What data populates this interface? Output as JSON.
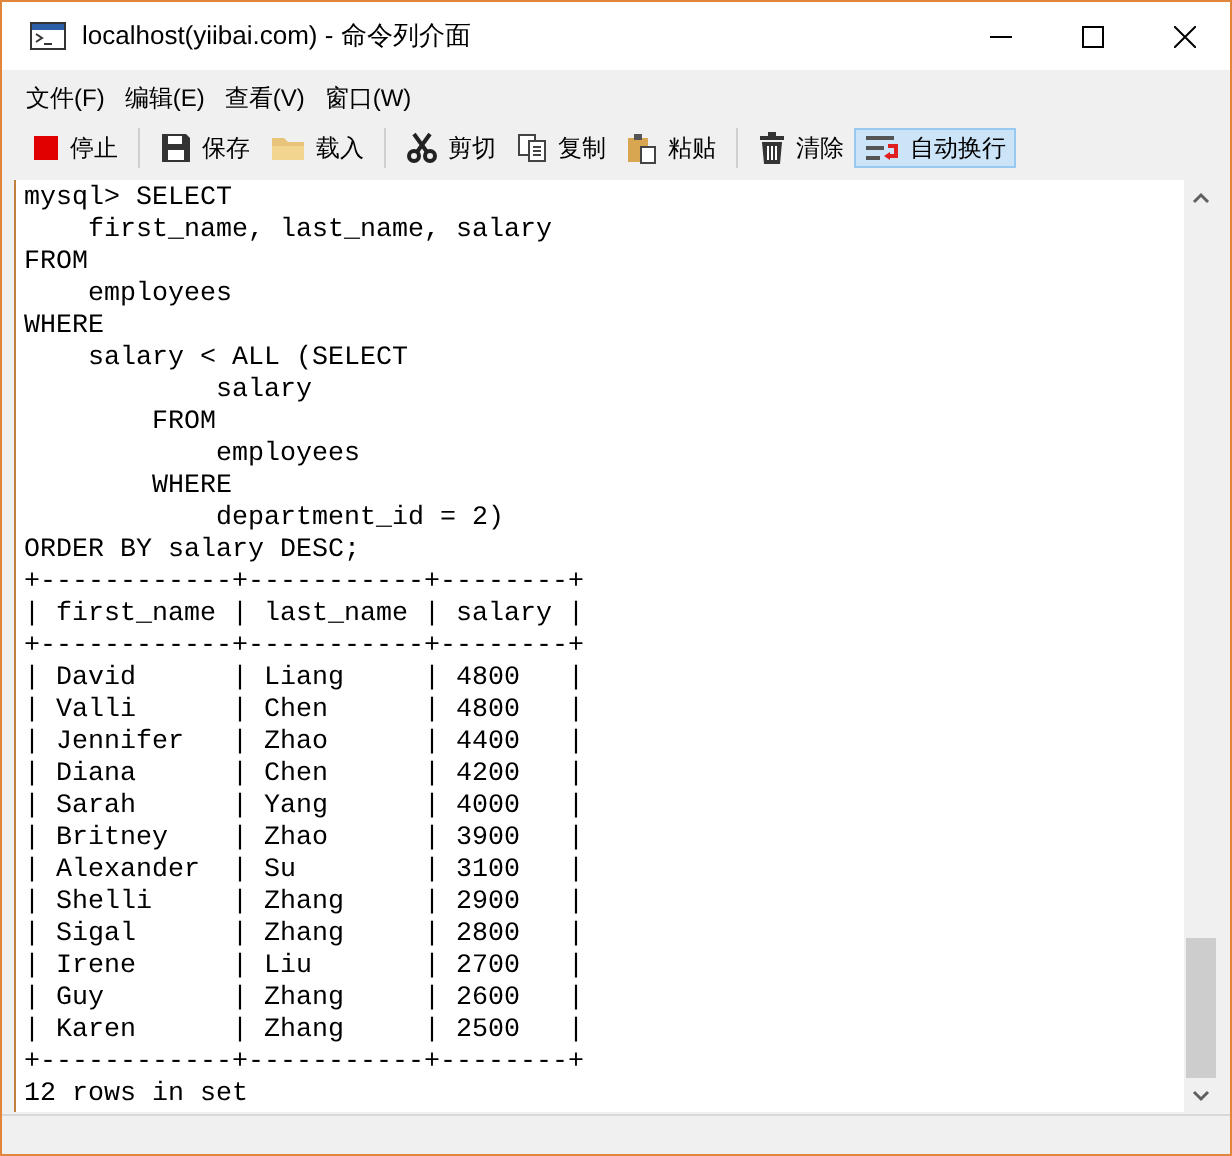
{
  "window": {
    "title": "localhost(yiibai.com) - 命令列介面"
  },
  "menu": [
    "文件(F)",
    "编辑(E)",
    "查看(V)",
    "窗口(W)"
  ],
  "toolbar": [
    {
      "kind": "stop",
      "label": "停止",
      "pressed": false
    },
    {
      "kind": "save",
      "label": "保存",
      "pressed": false
    },
    {
      "kind": "load",
      "label": "载入",
      "pressed": false
    },
    {
      "kind": "cut",
      "label": "剪切",
      "pressed": false
    },
    {
      "kind": "copy",
      "label": "复制",
      "pressed": false
    },
    {
      "kind": "paste",
      "label": "粘贴",
      "pressed": false
    },
    {
      "kind": "clear",
      "label": "清除",
      "pressed": false
    },
    {
      "kind": "wrap",
      "label": "自动换行",
      "pressed": true
    }
  ],
  "console": {
    "lines": [
      "mysql> SELECT",
      "    first_name, last_name, salary",
      "FROM",
      "    employees",
      "WHERE",
      "    salary < ALL (SELECT",
      "            salary",
      "        FROM",
      "            employees",
      "        WHERE",
      "            department_id = 2)",
      "ORDER BY salary DESC;",
      "+------------+-----------+--------+",
      "| first_name | last_name | salary |",
      "+------------+-----------+--------+",
      "| David      | Liang     | 4800   |",
      "| Valli      | Chen      | 4800   |",
      "| Jennifer   | Zhao      | 4400   |",
      "| Diana      | Chen      | 4200   |",
      "| Sarah      | Yang      | 4000   |",
      "| Britney    | Zhao      | 3900   |",
      "| Alexander  | Su        | 3100   |",
      "| Shelli     | Zhang     | 2900   |",
      "| Sigal      | Zhang     | 2800   |",
      "| Irene      | Liu       | 2700   |",
      "| Guy        | Zhang     | 2600   |",
      "| Karen      | Zhang     | 2500   |",
      "+------------+-----------+--------+",
      "12 rows in set"
    ]
  }
}
